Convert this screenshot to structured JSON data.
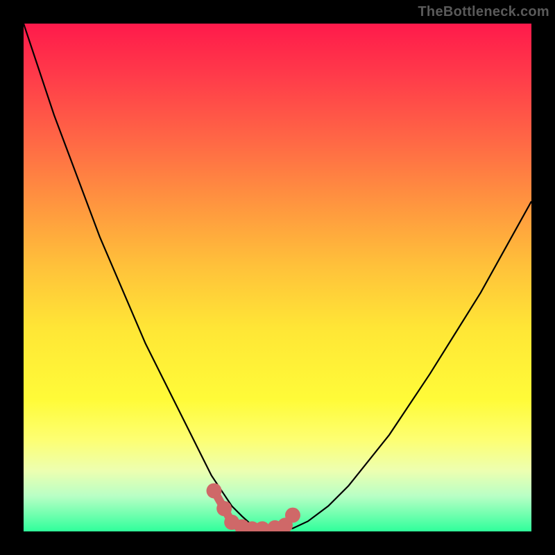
{
  "watermark": "TheBottleneck.com",
  "colors": {
    "line": "#000000",
    "marker_fill": "#cf6868",
    "marker_stroke": "#cf6868"
  },
  "chart_data": {
    "type": "line",
    "title": "",
    "xlabel": "",
    "ylabel": "",
    "xlim": [
      0,
      100
    ],
    "ylim": [
      0,
      100
    ],
    "grid": false,
    "legend": false,
    "series": [
      {
        "name": "bottleneck-curve",
        "x": [
          0,
          3,
          6,
          9,
          12,
          15,
          18,
          21,
          24,
          27,
          30,
          33,
          35,
          37,
          39,
          41,
          43,
          45,
          47,
          50,
          53,
          56,
          60,
          64,
          68,
          72,
          76,
          80,
          85,
          90,
          95,
          100
        ],
        "y": [
          100,
          91,
          82,
          74,
          66,
          58,
          51,
          44,
          37,
          31,
          25,
          19,
          15,
          11,
          8,
          5,
          3,
          1.2,
          0.4,
          0.2,
          0.6,
          2,
          5,
          9,
          14,
          19,
          25,
          31,
          39,
          47,
          56,
          65
        ]
      }
    ],
    "markers": {
      "name": "sweet-spot-markers",
      "x": [
        37.5,
        39.5,
        41,
        43,
        45,
        47,
        49.5,
        51.5,
        53
      ],
      "y": [
        8,
        4.5,
        1.8,
        0.9,
        0.5,
        0.5,
        0.7,
        1.2,
        3.2
      ],
      "radius_pct": 1.5
    }
  }
}
